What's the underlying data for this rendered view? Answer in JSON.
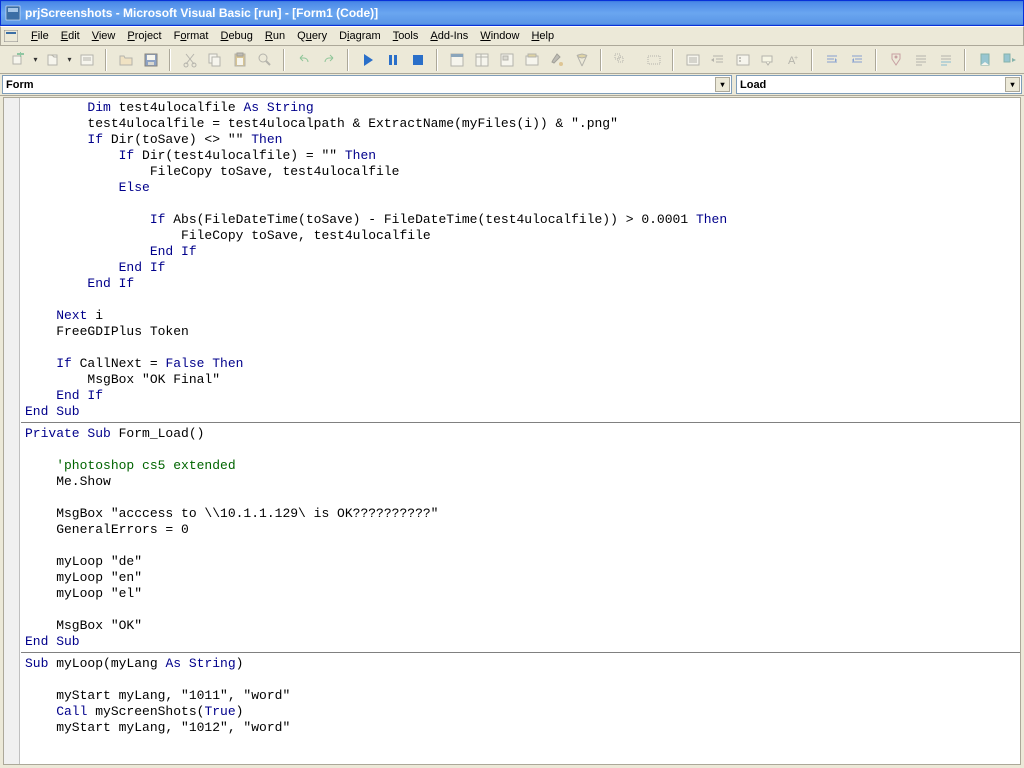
{
  "title": "prjScreenshots - Microsoft Visual Basic [run] - [Form1 (Code)]",
  "menus": {
    "file": "File",
    "edit": "Edit",
    "view": "View",
    "project": "Project",
    "format": "Format",
    "debug": "Debug",
    "run": "Run",
    "query": "Query",
    "diagram": "Diagram",
    "tools": "Tools",
    "addins": "Add-Ins",
    "window": "Window",
    "help": "Help"
  },
  "selectors": {
    "object": "Form",
    "procedure": "Load"
  },
  "code": {
    "l1a": "        Dim",
    "l1b": " test4ulocalfile ",
    "l1c": "As String",
    "l2": "        test4ulocalfile = test4ulocalpath & ExtractName(myFiles(i)) & \".png\"",
    "l3a": "        If",
    "l3b": " Dir(toSave) <> \"\" ",
    "l3c": "Then",
    "l4a": "            If",
    "l4b": " Dir(test4ulocalfile) = \"\" ",
    "l4c": "Then",
    "l5": "                FileCopy toSave, test4ulocalfile",
    "l6": "            Else",
    "l7": "            ",
    "l8a": "                If",
    "l8b": " Abs(FileDateTime(toSave) - FileDateTime(test4ulocalfile)) > 0.0001 ",
    "l8c": "Then",
    "l9": "                    FileCopy toSave, test4ulocalfile",
    "l10": "                End If",
    "l11": "            End If",
    "l12": "        End If",
    "l13": "        ",
    "l14a": "    Next",
    "l14b": " i",
    "l15": "    FreeGDIPlus Token",
    "l16": "    ",
    "l17a": "    If",
    "l17b": " CallNext = ",
    "l17c": "False Then",
    "l18": "        MsgBox \"OK Final\"",
    "l19": "    End If",
    "l20": "End Sub",
    "l21": "Private Sub",
    "l21b": " Form_Load()",
    "l22": "    ",
    "l23": "    'photoshop cs5 extended",
    "l24": "    Me.Show",
    "l25": "    ",
    "l26": "    MsgBox \"acccess to \\\\10.1.1.129\\ is OK??????????\"",
    "l27": "    GeneralErrors = 0",
    "l28": "    ",
    "l29": "    myLoop \"de\"",
    "l30": "    myLoop \"en\"",
    "l31": "    myLoop \"el\"",
    "l32": "    ",
    "l33": "    MsgBox \"OK\"",
    "l34": "End Sub",
    "l35": "Sub",
    "l35b": " myLoop(myLang ",
    "l35c": "As String",
    "l35d": ")",
    "l36": "    ",
    "l37": "    myStart myLang, \"1011\", \"word\"",
    "l38a": "    Call",
    "l38b": " myScreenShots(",
    "l38c": "True",
    "l38d": ")",
    "l39": "    myStart myLang, \"1012\", \"word\""
  }
}
